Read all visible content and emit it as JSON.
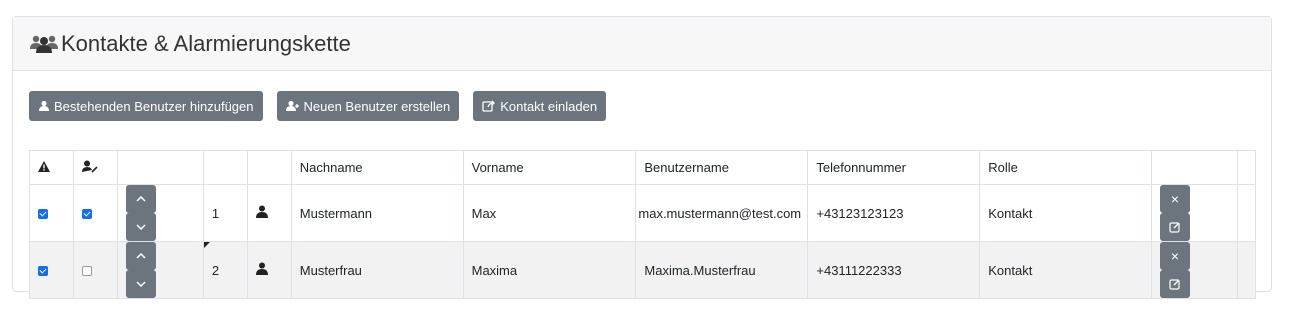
{
  "panel": {
    "title": "Kontakte & Alarmierungskette",
    "title_icon": "users-icon"
  },
  "toolbar": {
    "add_existing_label": "Bestehenden Benutzer hinzufügen",
    "create_new_label": "Neuen Benutzer erstellen",
    "invite_label": "Kontakt einladen"
  },
  "table": {
    "headers": {
      "alarm_icon": "warning-icon",
      "user_edit_icon": "user-edit-icon",
      "nachname": "Nachname",
      "vorname": "Vorname",
      "benutzername": "Benutzername",
      "telefon": "Telefonnummer",
      "rolle": "Rolle"
    },
    "rows": [
      {
        "alarm_checked": true,
        "user_checked": true,
        "position": "1",
        "nachname": "Mustermann",
        "vorname": "Max",
        "benutzername": "max.mustermann@test.com",
        "telefon": "+43123123123",
        "rolle": "Kontakt"
      },
      {
        "alarm_checked": true,
        "user_checked": false,
        "position": "2",
        "nachname": "Musterfrau",
        "vorname": "Maxima",
        "benutzername": "Maxima.Musterfrau",
        "telefon": "+43111222333",
        "rolle": "Kontakt"
      }
    ]
  },
  "colors": {
    "button_bg": "#6c757d",
    "checkbox_blue": "#0d6efd",
    "header_bg": "#f7f7f7"
  }
}
